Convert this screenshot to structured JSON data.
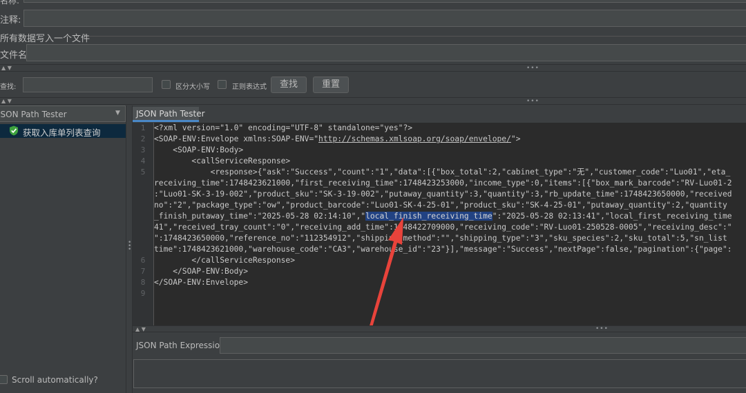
{
  "top": {
    "name_label": "名称:",
    "comment_label": "注释:",
    "write_all_label": "所有数据写入一个文件",
    "filename_label": "文件名"
  },
  "search": {
    "label": "查找:",
    "case_label": "区分大小写",
    "regex_label": "正则表达式",
    "find_button": "查找",
    "reset_button": "重置"
  },
  "left": {
    "dropdown_value": "JSON Path Tester",
    "tree_item": "获取入库单列表查询",
    "scroll_label": "Scroll automatically?"
  },
  "right": {
    "tab": "JSON Path Tester",
    "expression_label": "JSON Path Expression"
  },
  "code": {
    "line_numbers": [
      "1",
      "2",
      "3",
      "4",
      "5",
      "",
      "",
      "",
      "",
      "",
      "",
      "",
      "6",
      "7",
      "8",
      "9"
    ],
    "l1": "<?xml version=\"1.0\" encoding=\"UTF-8\" standalone=\"yes\"?>",
    "l2a": "<SOAP-ENV:Envelope xmlns:SOAP-ENV=\"",
    "l2link": "http://schemas.xmlsoap.org/soap/envelope/",
    "l2b": "\">",
    "l3": "    <SOAP-ENV:Body>",
    "l4": "        <callServiceResponse>",
    "l5": "            <response>{\"ask\":\"Success\",\"count\":\"1\",\"data\":[{\"box_total\":2,\"cabinet_type\":\"无\",\"customer_code\":\"Luo01\",\"eta_",
    "w1": "receiving_time\":1748423621000,\"first_receiving_time\":1748423253000,\"income_type\":0,\"items\":[{\"box_mark_barcode\":\"RV-Luo01-2",
    "w2": ":\"Luo01-SK-3-19-002\",\"product_sku\":\"SK-3-19-002\",\"putaway_quantity\":3,\"quantity\":3,\"rb_update_time\":1748423650000,\"received",
    "w3": "no\":\"2\",\"package_type\":\"ow\",\"product_barcode\":\"Luo01-SK-4-25-01\",\"product_sku\":\"SK-4-25-01\",\"putaway_quantity\":2,\"quantity",
    "w4a": "_finish_putaway_time\":\"2025-05-28 02:14:10\",\"",
    "w4hl": "local_finish_receiving_time",
    "w4b": "\":\"2025-05-28 02:13:41\",\"local_first_receiving_time",
    "w5": "41\",\"received_tray_count\":\"0\",\"receiving_add_time\":1748422709000,\"receiving_code\":\"RV-Luo01-250528-0005\",\"receiving_desc\":\"",
    "w6": "\":1748423650000,\"reference_no\":\"112354912\",\"shipping_method\":\"\",\"shipping_type\":\"3\",\"sku_species\":2,\"sku_total\":5,\"sn_list",
    "w7": "time\":1748423621000,\"warehouse_code\":\"CA3\",\"warehouse_id\":\"23\"}],\"message\":\"Success\",\"nextPage\":false,\"pagination\":{\"page\":",
    "l6": "        </callServiceResponse>",
    "l7": "    </SOAP-ENV:Body>",
    "l8": "</SOAP-ENV:Envelope>",
    "l9": ""
  },
  "colors": {
    "accent": "#4a88c7",
    "annotation_arrow": "#e8433b",
    "selection": "#214283"
  }
}
